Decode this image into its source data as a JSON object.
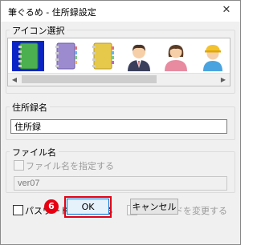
{
  "window": {
    "title": "筆ぐるめ - 住所録設定",
    "close_glyph": "✕"
  },
  "icon_group": {
    "legend": "アイコン選択",
    "icons": [
      {
        "name": "green-notebook-icon",
        "selected": true
      },
      {
        "name": "purple-notebook-icon",
        "selected": false
      },
      {
        "name": "yellow-notebook-icon",
        "selected": false
      },
      {
        "name": "businessman-icon",
        "selected": false
      },
      {
        "name": "woman-icon",
        "selected": false
      },
      {
        "name": "child-cap-icon",
        "selected": false
      }
    ]
  },
  "address_book_group": {
    "legend": "住所録名",
    "name_value": "住所録"
  },
  "file_group": {
    "legend": "ファイル名",
    "specify_checkbox_label": "ファイル名を指定する",
    "specify_checked": false,
    "filename_value": "ver07"
  },
  "password": {
    "set_label": "パスワードを設定する",
    "set_checked": false,
    "change_label": "パスワードを変更する",
    "change_checked": false
  },
  "buttons": {
    "ok": "OK",
    "cancel": "キャンセル"
  },
  "annotation": {
    "step_number": "6"
  },
  "colors": {
    "highlight": "#e60012",
    "selection": "#0a24c6"
  }
}
